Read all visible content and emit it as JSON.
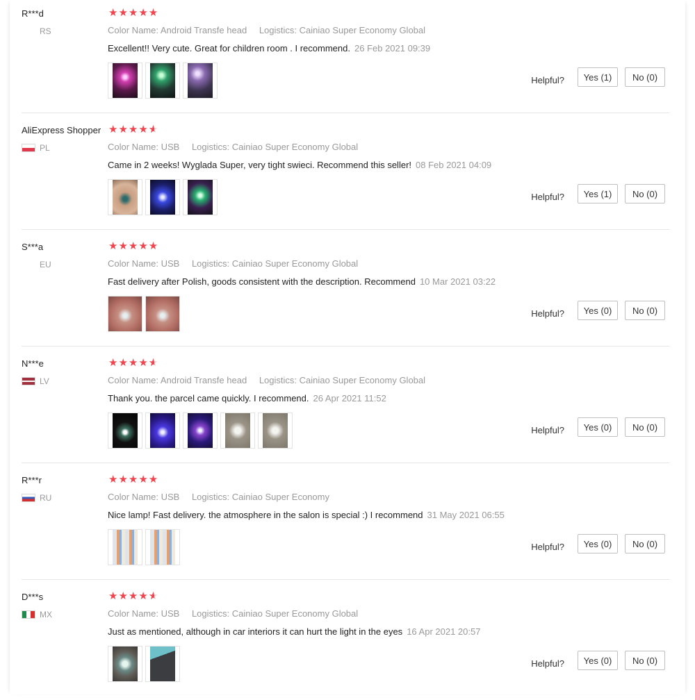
{
  "helpful_label": "Helpful?",
  "labels": {
    "color_name": "Color Name:",
    "logistics": "Logistics:"
  },
  "reviews": [
    {
      "user": "R***d",
      "country": "RS",
      "flag": "none",
      "stars": "★★★★★",
      "color_name": "Android Transfe head",
      "logistics": "Cainiao Super Economy Global",
      "comment": "Excellent!! Very cute. Great for children room . I recommend.",
      "date": "26 Feb 2021 09:39",
      "photos": [
        "pink-light-photo",
        "green-light-photo",
        "purple-light-photo"
      ],
      "yes": "Yes (1)",
      "no": "No (0)"
    },
    {
      "user": "AliExpress Shopper",
      "country": "PL",
      "flag": "pl",
      "stars": "★★★★",
      "color_name": "USB",
      "logistics": "Cainiao Super Economy Global",
      "comment": "Came in 2 weeks! Wyglada Super, very tight swieci. Recommend this seller!",
      "date": "08 Feb 2021 04:09",
      "photos": [
        "hand-with-device-photo",
        "blue-light-photo",
        "multicolor-light-photo"
      ],
      "yes": "Yes (1)",
      "no": "No (0)"
    },
    {
      "user": "S***a",
      "country": "EU",
      "flag": "none",
      "stars": "★★★★★",
      "color_name": "USB",
      "logistics": "Cainiao Super Economy Global",
      "comment": "Fast delivery after Polish, goods consistent with the description. Recommend",
      "date": "10 Mar 2021 03:22",
      "photos": [
        "device-in-palm-photo",
        "device-in-palm-photo-2"
      ],
      "yes": "Yes (0)",
      "no": "No (0)"
    },
    {
      "user": "N***e",
      "country": "LV",
      "flag": "lv",
      "stars": "★★★★",
      "color_name": "Android Transfe head",
      "logistics": "Cainiao Super Economy Global",
      "comment": "Thank you. the parcel came quickly. I recommend.",
      "date": "26 Apr 2021 11:52",
      "photos": [
        "dark-light-photo",
        "violet-light-photo",
        "violet-light-photo-2",
        "usb-device-photo",
        "usb-device-photo-2"
      ],
      "yes": "Yes (0)",
      "no": "No (0)"
    },
    {
      "user": "R***r",
      "country": "RU",
      "flag": "ru",
      "stars": "★★★★★",
      "color_name": "USB",
      "logistics": "Cainiao Super Economy",
      "comment": "Nice lamp! Fast delivery. the atmosphere in the salon is special :) I recommend",
      "date": "31 May 2021 06:55",
      "photos": [
        "fabric-photo",
        "fabric-photo-2"
      ],
      "yes": "Yes (0)",
      "no": "No (0)"
    },
    {
      "user": "D***s",
      "country": "MX",
      "flag": "mx",
      "stars": "★★★★",
      "color_name": "USB",
      "logistics": "Cainiao Super Economy Global",
      "comment": "Just as mentioned, although in car interiors it can hurt the light in the eyes",
      "date": "16 Apr 2021 20:57",
      "photos": [
        "round-device-photo",
        "car-interior-photo"
      ],
      "yes": "Yes (0)",
      "no": "No (0)"
    }
  ]
}
